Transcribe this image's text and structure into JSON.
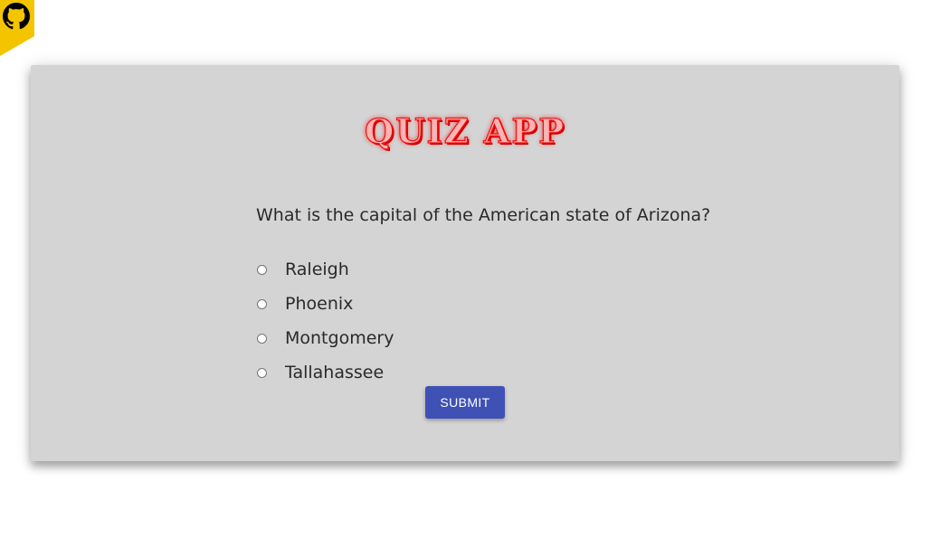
{
  "corner_link": {
    "icon": "github-icon",
    "color": "#f5c400"
  },
  "quiz": {
    "title": "QUIZ APP",
    "question": "What is the capital of the American state of Arizona?",
    "options": [
      {
        "label": "Raleigh",
        "selected": false
      },
      {
        "label": "Phoenix",
        "selected": false
      },
      {
        "label": "Montgomery",
        "selected": false
      },
      {
        "label": "Tallahassee",
        "selected": false
      }
    ],
    "submit_label": "SUBMIT"
  },
  "colors": {
    "card_background": "#d4d4d4",
    "title_red": "#ee1111",
    "submit_button": "#3f51b5"
  }
}
